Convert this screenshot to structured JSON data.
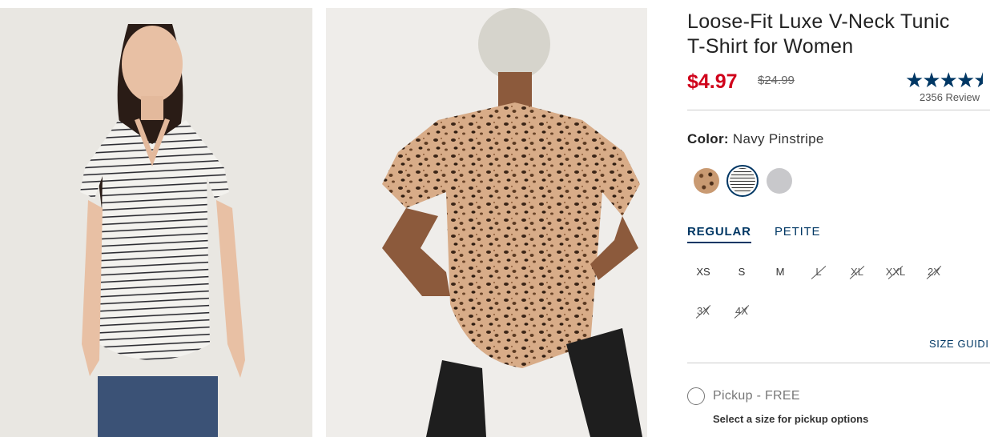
{
  "product": {
    "title_line1": "Loose-Fit Luxe V-Neck Tunic",
    "title_line2": "T-Shirt for Women",
    "sale_price": "$4.97",
    "original_price": "$24.99",
    "rating": 4.5,
    "rating_max": 5,
    "reviews": "2356 Review"
  },
  "color": {
    "label": "Color:",
    "selected": "Navy Pinstripe",
    "swatches": [
      "leopard",
      "navy-pinstripe",
      "heather-grey"
    ]
  },
  "fit_tabs": [
    {
      "label": "REGULAR",
      "active": true
    },
    {
      "label": "PETITE",
      "active": false
    }
  ],
  "sizes": [
    {
      "label": "XS",
      "available": true
    },
    {
      "label": "S",
      "available": true
    },
    {
      "label": "M",
      "available": true
    },
    {
      "label": "L",
      "available": false
    },
    {
      "label": "XL",
      "available": false
    },
    {
      "label": "XXL",
      "available": false
    },
    {
      "label": "2X",
      "available": false
    },
    {
      "label": "3X",
      "available": false
    },
    {
      "label": "4X",
      "available": false
    }
  ],
  "size_guide": "SIZE GUIDI",
  "pickup": {
    "label": "Pickup - FREE",
    "note": "Select a size for pickup options"
  },
  "colors": {
    "brand": "#003764",
    "sale": "#d0021b"
  }
}
